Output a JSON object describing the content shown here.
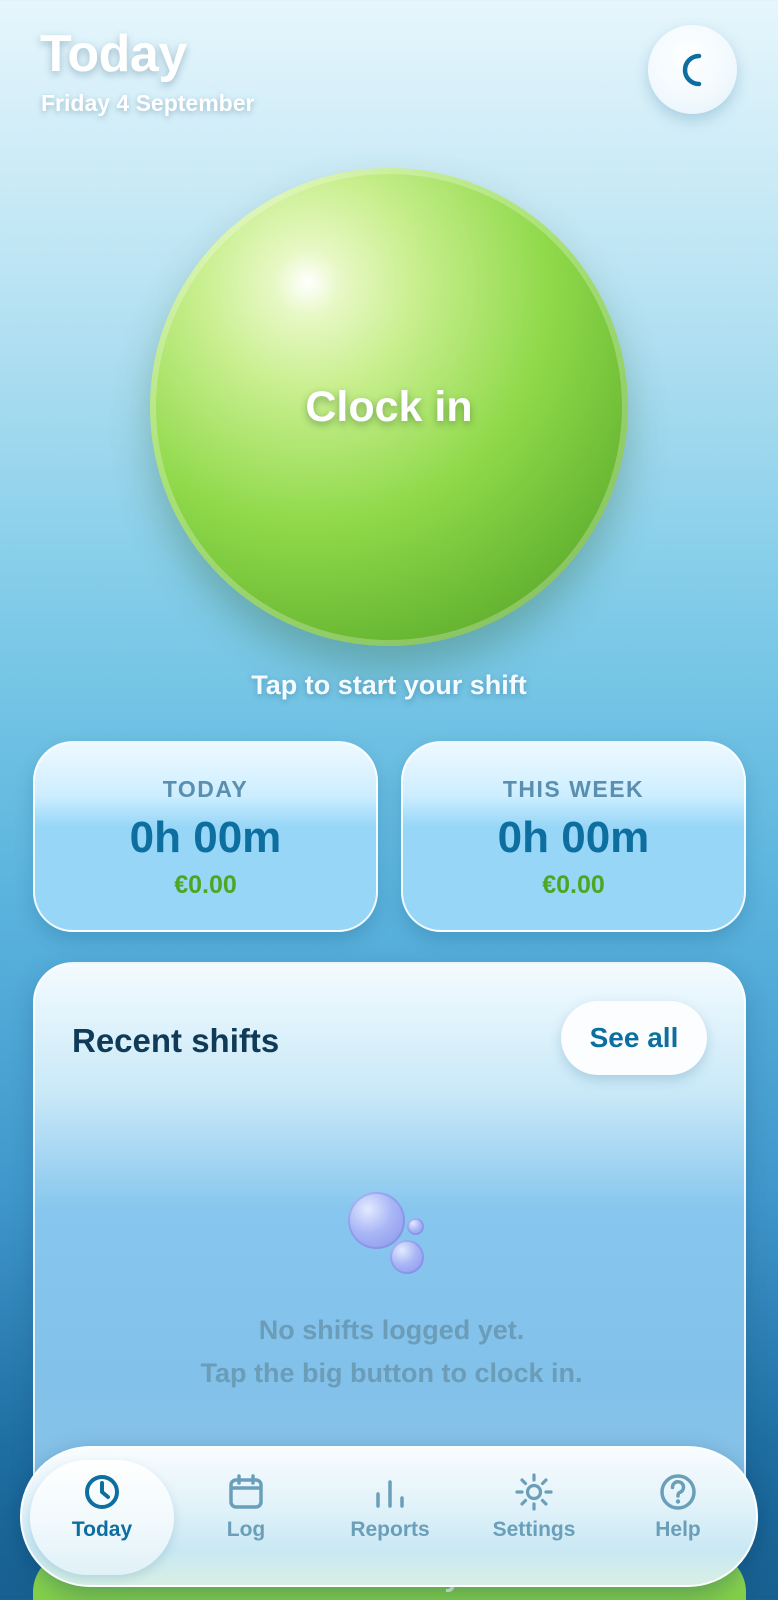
{
  "header": {
    "title": "Today",
    "date": "Friday 4 September",
    "theme_toggle_icon": "moon-icon"
  },
  "clock": {
    "button_label": "Clock in",
    "hint": "Tap to start your shift",
    "accent_color": "#8fd94a"
  },
  "stats": {
    "today": {
      "label": "TODAY",
      "duration": "0h 00m",
      "earnings": "€0.00"
    },
    "week": {
      "label": "THIS WEEK",
      "duration": "0h 00m",
      "earnings": "€0.00"
    }
  },
  "recent": {
    "title": "Recent shifts",
    "see_all_label": "See all",
    "empty_icon": "bubbles-icon",
    "empty_line1": "No shifts logged yet.",
    "empty_line2": "Tap the big button to clock in."
  },
  "add_shift": {
    "label": "+ Add a shift by hand"
  },
  "tabbar": {
    "active": "Today",
    "tabs": [
      {
        "label": "Today",
        "icon": "clock-icon"
      },
      {
        "label": "Log",
        "icon": "calendar-icon"
      },
      {
        "label": "Reports",
        "icon": "bar-chart-icon"
      },
      {
        "label": "Settings",
        "icon": "sun-icon"
      },
      {
        "label": "Help",
        "icon": "help-icon"
      }
    ]
  }
}
